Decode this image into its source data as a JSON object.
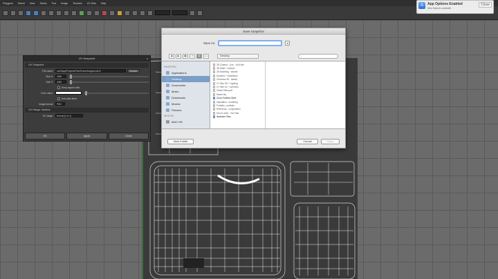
{
  "menubar": [
    "Polygons",
    "Select",
    "View",
    "Select",
    "Tool",
    "Image",
    "Textures",
    "UV Sets",
    "Help"
  ],
  "notification": {
    "title": "App Options Enabled",
    "subtitle": "New features available",
    "close": "Close"
  },
  "uv_panel": {
    "title": "UV Snapshot",
    "close": "x",
    "section1": "UV Snapshot",
    "file_label": "File name:",
    "file_value": "usr/Maya/Projects/Files/Scene/images/outUV",
    "browse": "Browse",
    "size_x_label": "Size X:",
    "size_x_value": "4096",
    "size_y_label": "Size Y:",
    "size_y_value": "4096",
    "keep_ratio": "Keep aspect ratio",
    "color_label": "Color value:",
    "antialias": "Anti-alias lines",
    "format_label": "Image format:",
    "format_value": "PNG",
    "section2": "UV Range Options",
    "range_label": "UV range:",
    "range_value": "Normal (0 to 1)",
    "btn_ok": "OK",
    "btn_apply": "Apply",
    "btn_close": "Close"
  },
  "save_dialog": {
    "title": "Save Snapshot",
    "save_as_label": "Save As:",
    "save_as_value": "",
    "location": "Desktop",
    "search_placeholder": "",
    "sidebar_header1": "FAVORITES",
    "sidebar": [
      "Applications",
      "Desktop",
      "Documents",
      "Music",
      "Downloads",
      "Movies",
      "Pictures"
    ],
    "sidebar_header2": "DEVICES",
    "device": "MAC HD",
    "files": [
      "3D Cinema - Live - YouTube",
      "3D Artist + Artwork",
      "3D Modeling - tutorial",
      "Dynamic + transitions",
      "Overview 3D - sketch",
      "CY files 3D + Lighting",
      "CY files 3d + overview",
      "Guitar Plans.pdf",
      "Model.obj",
      "Good Portfolio Sites",
      "Inspiration - modeling",
      "Portfolio - portfolio",
      "Reference - composition",
      "How to start - YouTube",
      "Illustrator Files"
    ],
    "new_folder": "New Folder",
    "cancel": "Cancel",
    "save": "Save"
  }
}
